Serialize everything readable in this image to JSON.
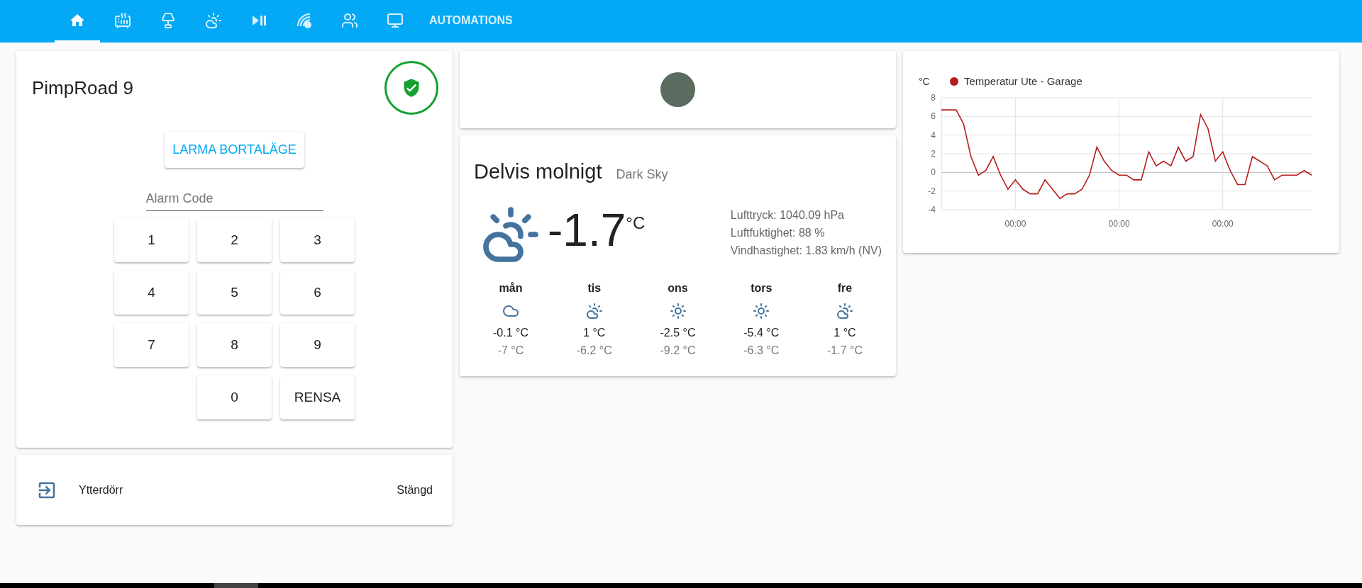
{
  "nav": {
    "tabs": [
      {
        "kind": "home",
        "selected": true
      },
      {
        "kind": "radiator",
        "selected": false
      },
      {
        "kind": "lamp",
        "selected": false
      },
      {
        "kind": "weather",
        "selected": false
      },
      {
        "kind": "media",
        "selected": false
      },
      {
        "kind": "zigbee",
        "selected": false
      },
      {
        "kind": "people",
        "selected": false
      },
      {
        "kind": "computer",
        "selected": false
      },
      {
        "kind": "text",
        "label": "AUTOMATIONS",
        "selected": false
      }
    ]
  },
  "alarm": {
    "title": "PimpRoad 9",
    "armed": true,
    "action_button": "LARMA BORTALÄGE",
    "code_field": {
      "placeholder": "Alarm Code"
    },
    "keypad": [
      "1",
      "2",
      "3",
      "4",
      "5",
      "6",
      "7",
      "8",
      "9",
      "0",
      "RENSA"
    ]
  },
  "door": {
    "name": "Ytterdörr",
    "state": "Stängd"
  },
  "weather": {
    "condition": "Delvis molnigt",
    "source": "Dark Sky",
    "kind": "partlycloudy",
    "temperature": "-1.7",
    "unit": "°C",
    "attributes": [
      "Lufttryck: 1040.09 hPa",
      "Luftfuktighet: 88 %",
      "Vindhastighet: 1.83 km/h (NV)"
    ],
    "forecast": [
      {
        "day": "mån",
        "kind": "cloudy",
        "high": "-0.1 °C",
        "low": "-7 °C"
      },
      {
        "day": "tis",
        "kind": "partlycloudy",
        "high": "1 °C",
        "low": "-6.2 °C"
      },
      {
        "day": "ons",
        "kind": "sunny",
        "high": "-2.5 °C",
        "low": "-9.2 °C"
      },
      {
        "day": "tors",
        "kind": "sunny",
        "high": "-5.4 °C",
        "low": "-6.3 °C"
      },
      {
        "day": "fre",
        "kind": "partlycloudy",
        "high": "1 °C",
        "low": "-1.7 °C"
      }
    ]
  },
  "history": {
    "chart_data": {
      "type": "line",
      "grid": true,
      "ylabel": "°C",
      "ylim": [
        -4,
        8
      ],
      "yticks": [
        -4,
        -2,
        0,
        2,
        4,
        6,
        8
      ],
      "categories": [
        null,
        null,
        null,
        null,
        null,
        null,
        null,
        null,
        null,
        null,
        "00:00",
        null,
        null,
        null,
        null,
        null,
        null,
        null,
        null,
        null,
        null,
        null,
        null,
        null,
        "00:00",
        null,
        null,
        null,
        null,
        null,
        null,
        null,
        null,
        null,
        null,
        null,
        null,
        null,
        "00:00",
        null,
        null,
        null,
        null,
        null,
        null,
        null,
        null,
        null,
        null,
        null,
        null
      ],
      "series": [
        {
          "name": "Temperatur Ute - Garage",
          "color": "#b71c1c",
          "values": [
            6.7,
            6.7,
            6.7,
            5.2,
            1.7,
            -0.3,
            0.2,
            1.7,
            -0.3,
            -1.8,
            -0.8,
            -1.8,
            -2.3,
            -2.3,
            -0.8,
            -1.8,
            -2.8,
            -2.3,
            -2.3,
            -1.8,
            -0.3,
            2.7,
            1.2,
            0.2,
            -0.3,
            -0.3,
            -0.8,
            -0.8,
            2.2,
            0.7,
            1.2,
            0.7,
            2.7,
            1.2,
            1.7,
            6.2,
            4.7,
            1.2,
            2.2,
            0.2,
            -1.3,
            -1.3,
            1.7,
            1.2,
            0.7,
            -0.8,
            -0.3,
            -0.3,
            -0.3,
            0.2,
            -0.3
          ]
        }
      ]
    }
  }
}
